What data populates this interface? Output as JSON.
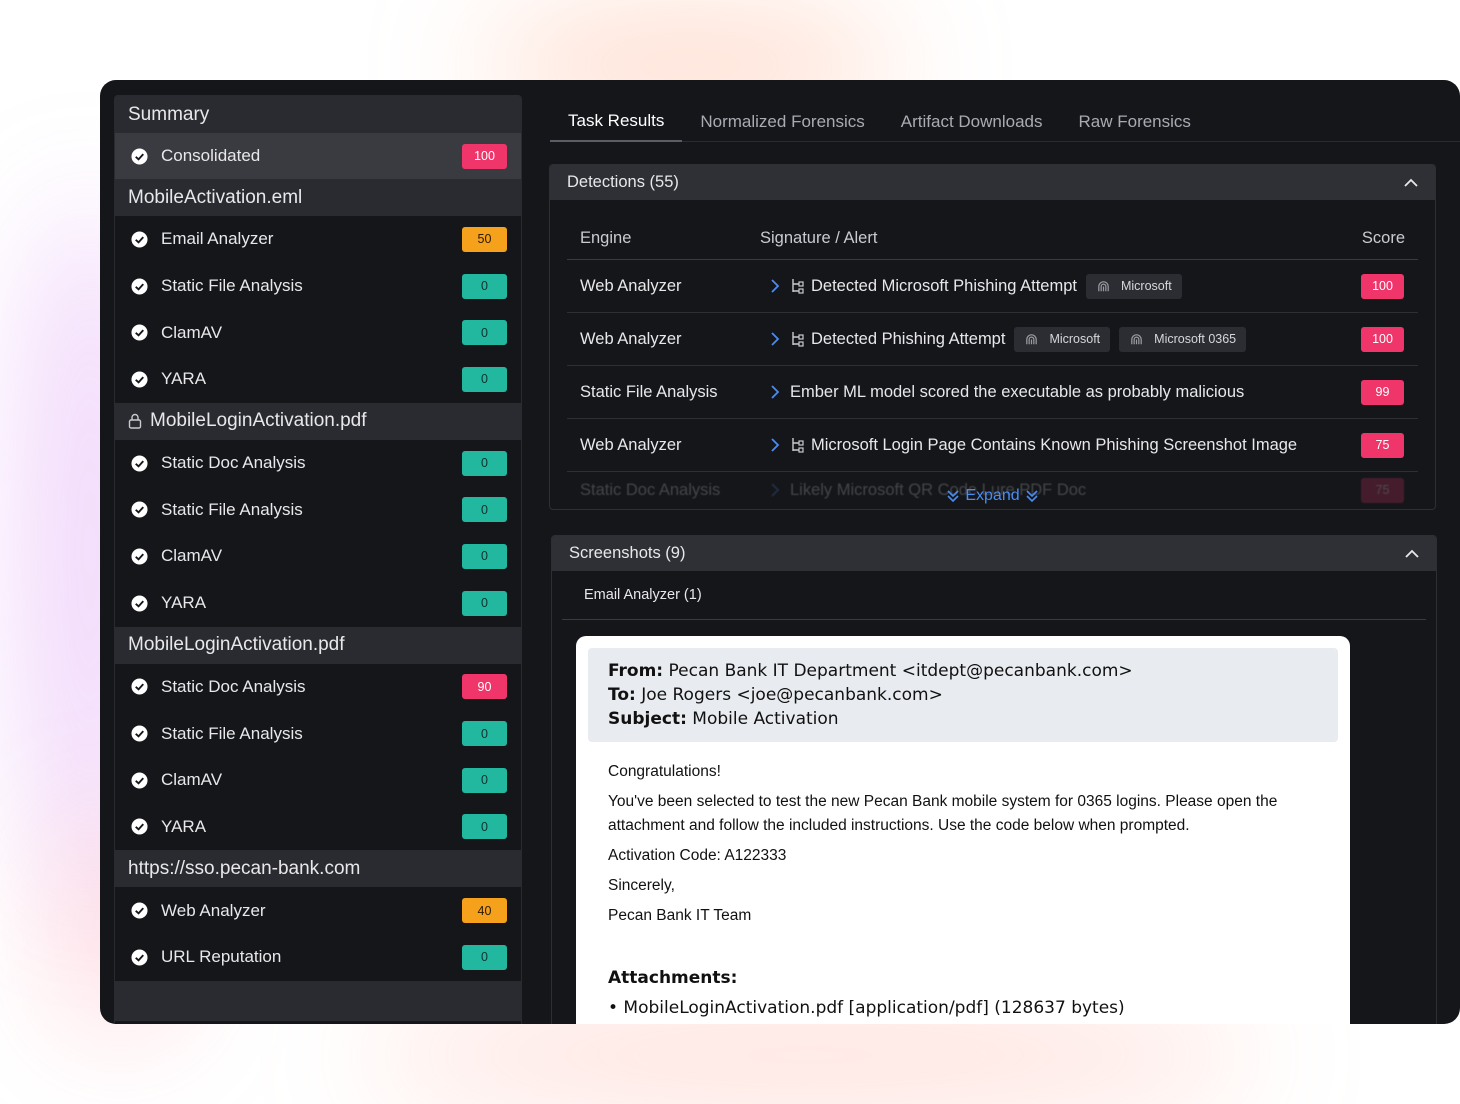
{
  "sidebar": {
    "groups": [
      {
        "title": "Summary",
        "locked": false,
        "items": [
          {
            "label": "Consolidated",
            "score": "100",
            "level": "red",
            "active": true
          }
        ]
      },
      {
        "title": "MobileActivation.eml",
        "locked": false,
        "items": [
          {
            "label": "Email Analyzer",
            "score": "50",
            "level": "orange"
          },
          {
            "label": "Static File Analysis",
            "score": "0",
            "level": "green"
          },
          {
            "label": "ClamAV",
            "score": "0",
            "level": "green"
          },
          {
            "label": "YARA",
            "score": "0",
            "level": "green"
          }
        ]
      },
      {
        "title": "MobileLoginActivation.pdf",
        "locked": true,
        "items": [
          {
            "label": "Static Doc Analysis",
            "score": "0",
            "level": "green"
          },
          {
            "label": "Static File Analysis",
            "score": "0",
            "level": "green"
          },
          {
            "label": "ClamAV",
            "score": "0",
            "level": "green"
          },
          {
            "label": "YARA",
            "score": "0",
            "level": "green"
          }
        ]
      },
      {
        "title": "MobileLoginActivation.pdf",
        "locked": false,
        "items": [
          {
            "label": "Static Doc Analysis",
            "score": "90",
            "level": "red"
          },
          {
            "label": "Static File Analysis",
            "score": "0",
            "level": "green"
          },
          {
            "label": "ClamAV",
            "score": "0",
            "level": "green"
          },
          {
            "label": "YARA",
            "score": "0",
            "level": "green"
          }
        ]
      },
      {
        "title": "https://sso.pecan-bank.com",
        "locked": false,
        "items": [
          {
            "label": "Web Analyzer",
            "score": "40",
            "level": "orange"
          },
          {
            "label": "URL Reputation",
            "score": "0",
            "level": "green"
          }
        ]
      }
    ]
  },
  "tabs": [
    {
      "label": "Task Results",
      "active": true
    },
    {
      "label": "Normalized Forensics",
      "active": false
    },
    {
      "label": "Artifact Downloads",
      "active": false
    },
    {
      "label": "Raw Forensics",
      "active": false
    }
  ],
  "detections": {
    "title": "Detections (55)",
    "columns": {
      "engine": "Engine",
      "signature": "Signature / Alert",
      "score": "Score"
    },
    "rows": [
      {
        "engine": "Web Analyzer",
        "signature": "Detected Microsoft Phishing Attempt",
        "tree": true,
        "tags": [
          "Microsoft"
        ],
        "score": "100"
      },
      {
        "engine": "Web Analyzer",
        "signature": "Detected Phishing Attempt",
        "tree": true,
        "tags": [
          "Microsoft",
          "Microsoft 0365"
        ],
        "score": "100"
      },
      {
        "engine": "Static File Analysis",
        "signature": "Ember ML model scored the executable as probably malicious",
        "tree": false,
        "tags": [],
        "score": "99"
      },
      {
        "engine": "Web Analyzer",
        "signature": "Microsoft Login Page Contains Known Phishing Screenshot Image",
        "tree": true,
        "tags": [],
        "score": "75"
      }
    ],
    "faded_row": {
      "engine": "Static Doc Analysis",
      "signature": "Likely Microsoft QR Code Lure PDF Doc",
      "score": "75"
    },
    "expand_label": "Expand"
  },
  "screenshots": {
    "title": "Screenshots (9)",
    "subtab": "Email Analyzer (1)",
    "email": {
      "from_label": "From:",
      "from": "Pecan Bank IT Department <itdept@pecanbank.com>",
      "to_label": "To:",
      "to": "Joe Rogers <joe@pecanbank.com>",
      "subject_label": "Subject:",
      "subject": "Mobile Activation",
      "body": [
        "Congratulations!",
        "You've been selected to test the new Pecan Bank mobile system for 0365 logins. Please open the attachment and follow the included instructions. Use the code below when prompted.",
        "Activation Code: A122333",
        "Sincerely,",
        "Pecan Bank IT Team"
      ],
      "attachments_label": "Attachments:",
      "attachments": [
        "• MobileLoginActivation.pdf [application/pdf] (128637 bytes)"
      ]
    }
  },
  "colors": {
    "green": "#22b8a0",
    "orange": "#f5a11c",
    "red": "#f0356b",
    "link": "#4a8cf0"
  }
}
